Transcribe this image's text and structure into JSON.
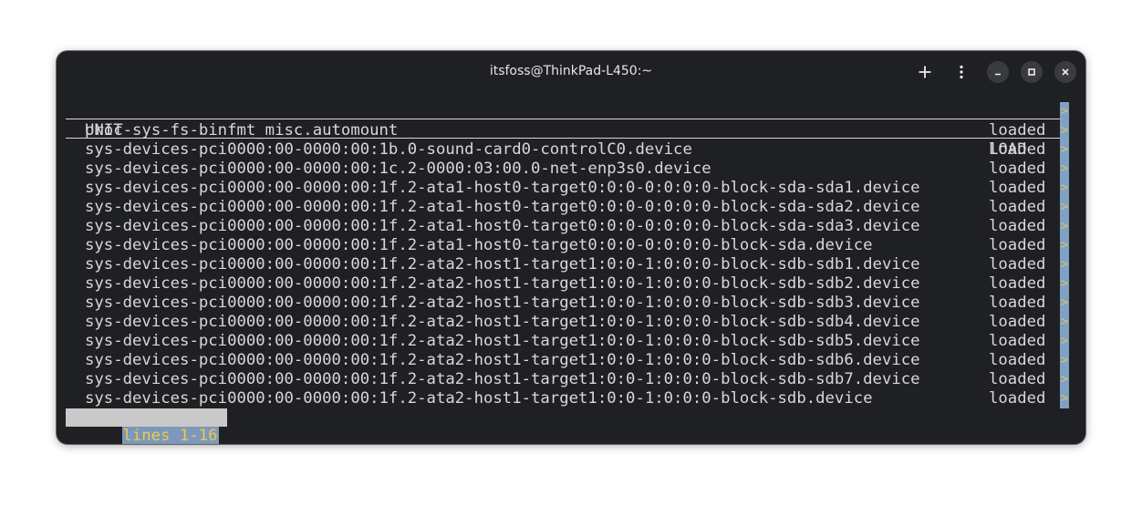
{
  "window": {
    "title": "itsfoss@ThinkPad-L450:~"
  },
  "titlebar": {
    "new_tab_icon": "plus-icon",
    "menu_icon": "kebab-menu-icon",
    "minimize_icon": "minimize-icon",
    "maximize_icon": "maximize-icon",
    "close_icon": "close-icon"
  },
  "terminal": {
    "header": {
      "unit": "UNIT",
      "load": "LOAD"
    },
    "rows": [
      {
        "unit": "proc-sys-fs-binfmt_misc.automount",
        "load": "loaded"
      },
      {
        "unit": "sys-devices-pci0000:00-0000:00:1b.0-sound-card0-controlC0.device",
        "load": "loaded"
      },
      {
        "unit": "sys-devices-pci0000:00-0000:00:1c.2-0000:03:00.0-net-enp3s0.device",
        "load": "loaded"
      },
      {
        "unit": "sys-devices-pci0000:00-0000:00:1f.2-ata1-host0-target0:0:0-0:0:0:0-block-sda-sda1.device",
        "load": "loaded"
      },
      {
        "unit": "sys-devices-pci0000:00-0000:00:1f.2-ata1-host0-target0:0:0-0:0:0:0-block-sda-sda2.device",
        "load": "loaded"
      },
      {
        "unit": "sys-devices-pci0000:00-0000:00:1f.2-ata1-host0-target0:0:0-0:0:0:0-block-sda-sda3.device",
        "load": "loaded"
      },
      {
        "unit": "sys-devices-pci0000:00-0000:00:1f.2-ata1-host0-target0:0:0-0:0:0:0-block-sda.device",
        "load": "loaded"
      },
      {
        "unit": "sys-devices-pci0000:00-0000:00:1f.2-ata2-host1-target1:0:0-1:0:0:0-block-sdb-sdb1.device",
        "load": "loaded"
      },
      {
        "unit": "sys-devices-pci0000:00-0000:00:1f.2-ata2-host1-target1:0:0-1:0:0:0-block-sdb-sdb2.device",
        "load": "loaded"
      },
      {
        "unit": "sys-devices-pci0000:00-0000:00:1f.2-ata2-host1-target1:0:0-1:0:0:0-block-sdb-sdb3.device",
        "load": "loaded"
      },
      {
        "unit": "sys-devices-pci0000:00-0000:00:1f.2-ata2-host1-target1:0:0-1:0:0:0-block-sdb-sdb4.device",
        "load": "loaded"
      },
      {
        "unit": "sys-devices-pci0000:00-0000:00:1f.2-ata2-host1-target1:0:0-1:0:0:0-block-sdb-sdb5.device",
        "load": "loaded"
      },
      {
        "unit": "sys-devices-pci0000:00-0000:00:1f.2-ata2-host1-target1:0:0-1:0:0:0-block-sdb-sdb6.device",
        "load": "loaded"
      },
      {
        "unit": "sys-devices-pci0000:00-0000:00:1f.2-ata2-host1-target1:0:0-1:0:0:0-block-sdb-sdb7.device",
        "load": "loaded"
      },
      {
        "unit": "sys-devices-pci0000:00-0000:00:1f.2-ata2-host1-target1:0:0-1:0:0:0-block-sdb.device",
        "load": "loaded"
      }
    ],
    "overflow_marker": ">",
    "status": "lines 1-16"
  },
  "colors": {
    "window_bg": "#1f2023",
    "text": "#d8d8d8",
    "scroll_marker_bg": "#7fa2c4",
    "status_text": "#ecc94d"
  }
}
